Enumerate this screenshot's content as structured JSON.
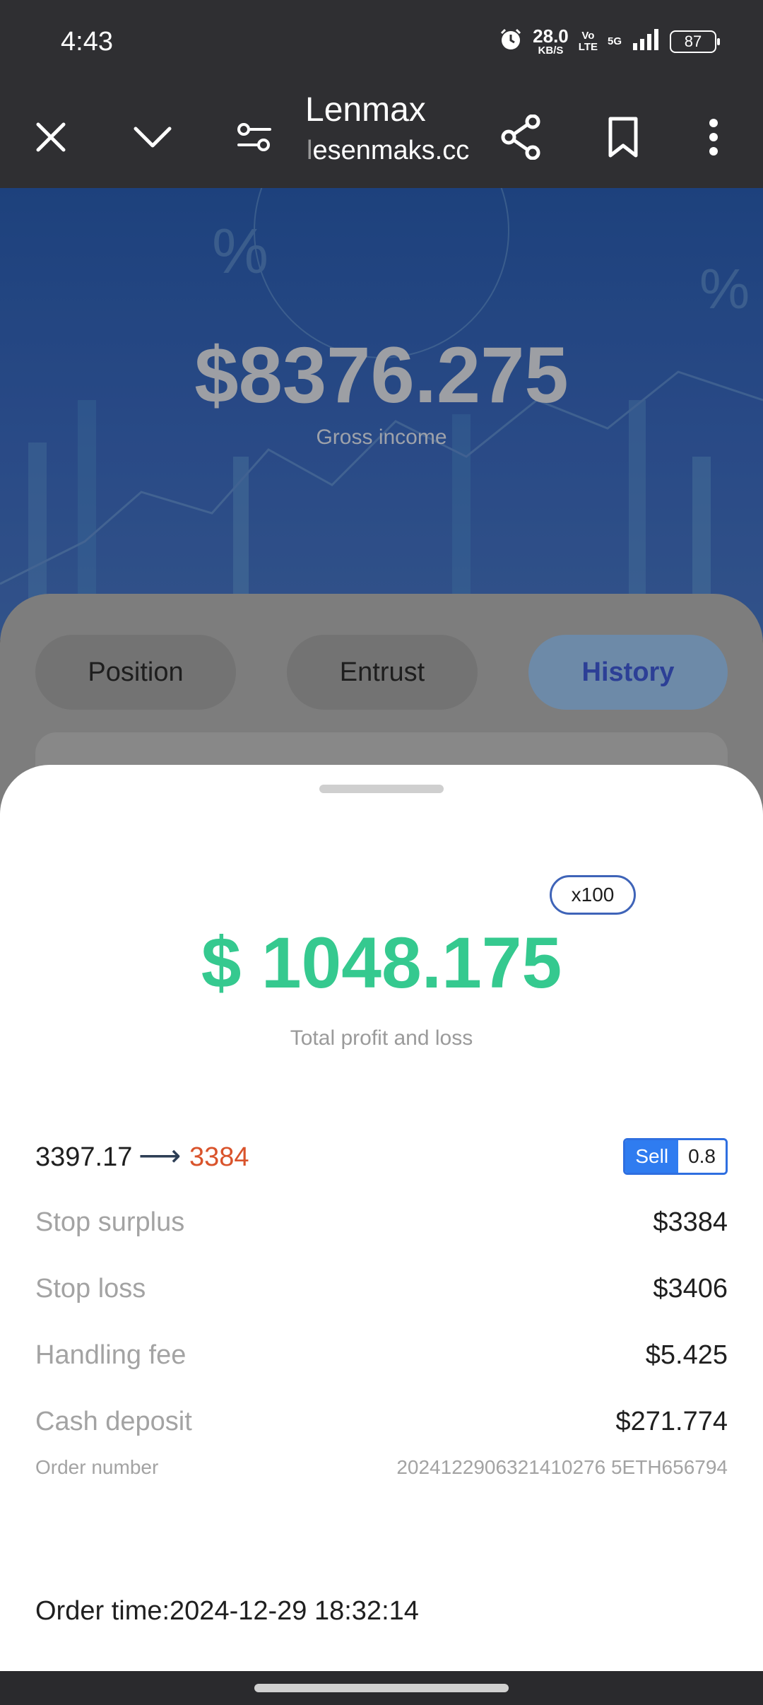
{
  "status_bar": {
    "time": "4:43",
    "speed_value": "28.0",
    "speed_unit": "KB/S",
    "volte_top": "Vo",
    "volte_bottom": "LTE",
    "network": "5G",
    "battery": "87"
  },
  "browser": {
    "title": "Lenmax",
    "url_prefix": "l",
    "url_rest": "esenmaks.cc",
    "icons": [
      "close-icon",
      "chevron-down-icon",
      "tune-icon",
      "share-icon",
      "bookmark-icon",
      "more-vert-icon"
    ]
  },
  "hero": {
    "amount": "$8376.275",
    "label": "Gross income"
  },
  "tabs": [
    {
      "label": "Position"
    },
    {
      "label": "Entrust"
    },
    {
      "label": "History"
    }
  ],
  "sheet": {
    "leverage": "x100",
    "pl_amount": "$ 1048.175",
    "pl_label": "Total profit and loss",
    "open_price": "3397.17",
    "arrow": "⟶",
    "close_price": "3384",
    "side": "Sell",
    "qty": "0.8",
    "rows": [
      {
        "label": "Stop surplus",
        "value": "$3384"
      },
      {
        "label": "Stop loss",
        "value": "$3406"
      },
      {
        "label": "Handling fee",
        "value": "$5.425"
      },
      {
        "label": "Cash deposit",
        "value": "$271.774"
      }
    ],
    "order_number_label": "Order number",
    "order_number": "2024122906321410276 5ETH656794",
    "order_time": "Order time:2024-12-29 18:32:14"
  },
  "colors": {
    "profit": "#35c98f",
    "close_price": "#d9532b",
    "sell": "#2f7cf0",
    "hero_blue": "#2c61b8"
  }
}
